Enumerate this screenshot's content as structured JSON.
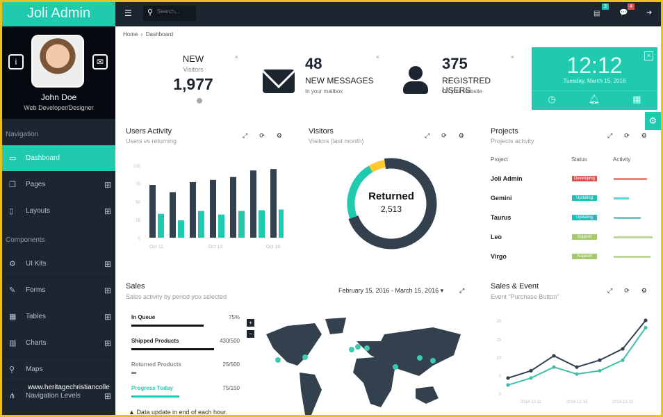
{
  "app": {
    "title": "Joli Admin"
  },
  "topbar": {
    "search_placeholder": "Search...",
    "tasks_badge": "3",
    "messages_badge": "4"
  },
  "profile": {
    "name": "John Doe",
    "role": "Web Developer/Designer"
  },
  "sidebar": {
    "sections": [
      "Navigation",
      "Components"
    ],
    "items": [
      {
        "label": "Dashboard",
        "icon": "monitor-icon"
      },
      {
        "label": "Pages",
        "icon": "pages-icon"
      },
      {
        "label": "Layouts",
        "icon": "file-icon"
      },
      {
        "label": "UI Kits",
        "icon": "cogs-icon"
      },
      {
        "label": "Forms",
        "icon": "pencil-icon"
      },
      {
        "label": "Tables",
        "icon": "table-icon"
      },
      {
        "label": "Charts",
        "icon": "chart-icon"
      },
      {
        "label": "Maps",
        "icon": "map-pin-icon"
      },
      {
        "label": "Navigation Levels",
        "icon": "sitemap-icon"
      }
    ]
  },
  "watermark": "www.heritagechristiancolle",
  "breadcrumb": [
    "Home",
    "Dashboard"
  ],
  "stats": {
    "visitors": {
      "title": "NEW",
      "sub": "Visitors",
      "value": "1,977"
    },
    "messages": {
      "value": "48",
      "title": "NEW MESSAGES",
      "sub": "In your mailbox"
    },
    "users": {
      "value": "375",
      "title": "REGISTRED USERS",
      "sub": "On your website"
    }
  },
  "clock": {
    "time": "12:12",
    "date": "Tuesday, March 15, 2016"
  },
  "users_activity": {
    "title": "Users Activity",
    "subtitle": "Users vs returning"
  },
  "visitors_panel": {
    "title": "Visitors",
    "subtitle": "Visitors (last month)",
    "center_label": "Returned",
    "center_value": "2,513"
  },
  "projects": {
    "title": "Projects",
    "subtitle": "Projects activity",
    "headers": [
      "Project",
      "Status",
      "Activity"
    ],
    "rows": [
      {
        "name": "Joli Admin",
        "status": "Developing",
        "color": "#d9534f",
        "activity": 85
      },
      {
        "name": "Gemini",
        "status": "Updating",
        "color": "#1fbfb8",
        "activity": 40
      },
      {
        "name": "Taurus",
        "status": "Updating",
        "color": "#1fbfb8",
        "activity": 70
      },
      {
        "name": "Leo",
        "status": "Support",
        "color": "#a5c96b",
        "activity": 100
      },
      {
        "name": "Virgo",
        "status": "Support",
        "color": "#a5c96b",
        "activity": 95
      }
    ]
  },
  "sales": {
    "title": "Sales",
    "subtitle": "Sales activity by period you selected",
    "date_range": "February 15, 2016 - March 15, 2016",
    "progress": [
      {
        "label": "In Queue",
        "value": "75%",
        "pct": 75,
        "color": "#111"
      },
      {
        "label": "Shipped Products",
        "value": "430/500",
        "pct": 86,
        "color": "#111"
      },
      {
        "label": "Returned Products",
        "value": "25/500",
        "pct": 5,
        "color": "#888"
      },
      {
        "label": "Progress Today",
        "value": "75/150",
        "pct": 50,
        "color": "#1fcaae"
      }
    ],
    "note": "Data update in end of each hour."
  },
  "sales_event": {
    "title": "Sales & Event",
    "subtitle": "Event \"Purchase Button\""
  },
  "chart_data": [
    {
      "type": "bar",
      "categories": [
        "Oct 11",
        "",
        "",
        "Oct 13",
        "",
        "",
        "Oct 16"
      ],
      "tick_labels": [
        "Oct 11",
        "Oct 13",
        "Oct 16"
      ],
      "yticks": [
        "100",
        "75",
        "50",
        "25",
        "0"
      ],
      "ylim": [
        0,
        100
      ],
      "series": [
        {
          "values": [
            73,
            63,
            77,
            80,
            84,
            93,
            95
          ],
          "color": "#33414e"
        },
        {
          "values": [
            33,
            24,
            37,
            32,
            37,
            38,
            39
          ],
          "color": "#1fcaae"
        }
      ]
    },
    {
      "type": "pie",
      "donut": true,
      "values": [
        72,
        22,
        6
      ],
      "colors": [
        "#33414e",
        "#1fcaae",
        "#fec92b"
      ]
    },
    {
      "type": "line",
      "xticks": [
        "2014-10-11",
        "2014-12-15",
        "2014-12-31"
      ],
      "yticks": [
        "20",
        "15",
        "10",
        "5",
        "0"
      ],
      "ylim": [
        0,
        20
      ],
      "series": [
        {
          "values": [
            4.2,
            6.2,
            10.3,
            7.2,
            9.1,
            12.2,
            20
          ],
          "color": "#33414e"
        },
        {
          "values": [
            2.3,
            4.2,
            7.2,
            5.3,
            6.2,
            9.1,
            18
          ],
          "color": "#3fbfa8"
        }
      ]
    }
  ]
}
